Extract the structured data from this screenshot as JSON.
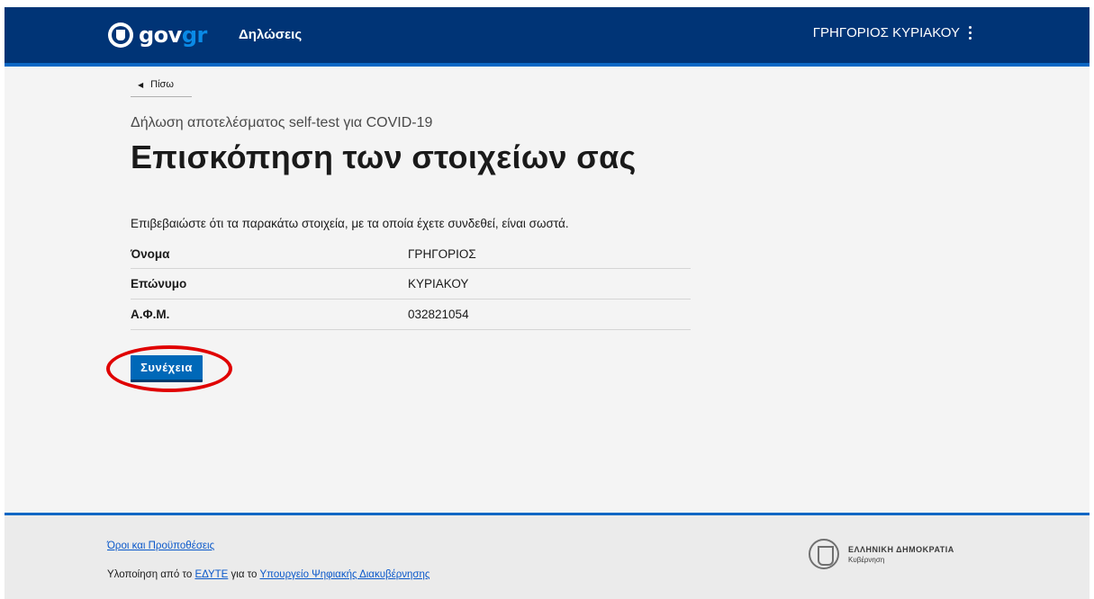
{
  "header": {
    "logo_main": "gov",
    "logo_accent": "gr",
    "service_name": "Δηλώσεις",
    "user_name": "ΓΡΗΓΟΡΙΟΣ ΚΥΡΙΑΚΟΥ"
  },
  "main": {
    "back_label": "Πίσω",
    "subtitle": "Δήλωση αποτελέσματος self-test για COVID-19",
    "title": "Επισκόπηση των στοιχείων σας",
    "intro": "Επιβεβαιώστε ότι τα παρακάτω στοιχεία, με τα οποία έχετε συνδεθεί, είναι σωστά.",
    "details": [
      {
        "label": "Όνομα",
        "value": "ΓΡΗΓΟΡΙΟΣ"
      },
      {
        "label": "Επώνυμο",
        "value": "ΚΥΡΙΑΚΟΥ"
      },
      {
        "label": "Α.Φ.Μ.",
        "value": "032821054"
      }
    ],
    "continue_label": "Συνέχεια"
  },
  "footer": {
    "terms_link": "Όροι και Προϋποθέσεις",
    "credit_prefix": "Υλοποίηση από το",
    "credit_org": "ΕΔΥΤΕ",
    "credit_middle": "για το",
    "credit_ministry": "Υπουργείο Ψηφιακής Διακυβέρνησης",
    "badge_title": "ΕΛΛΗΝΙΚΗ ΔΗΜΟΚΡΑΤΙΑ",
    "badge_subtitle": "Κυβέρνηση"
  },
  "colors": {
    "header_bg": "#003476",
    "accent": "#0a67c4",
    "button_bg": "#0068b8",
    "highlight": "#e00000"
  }
}
